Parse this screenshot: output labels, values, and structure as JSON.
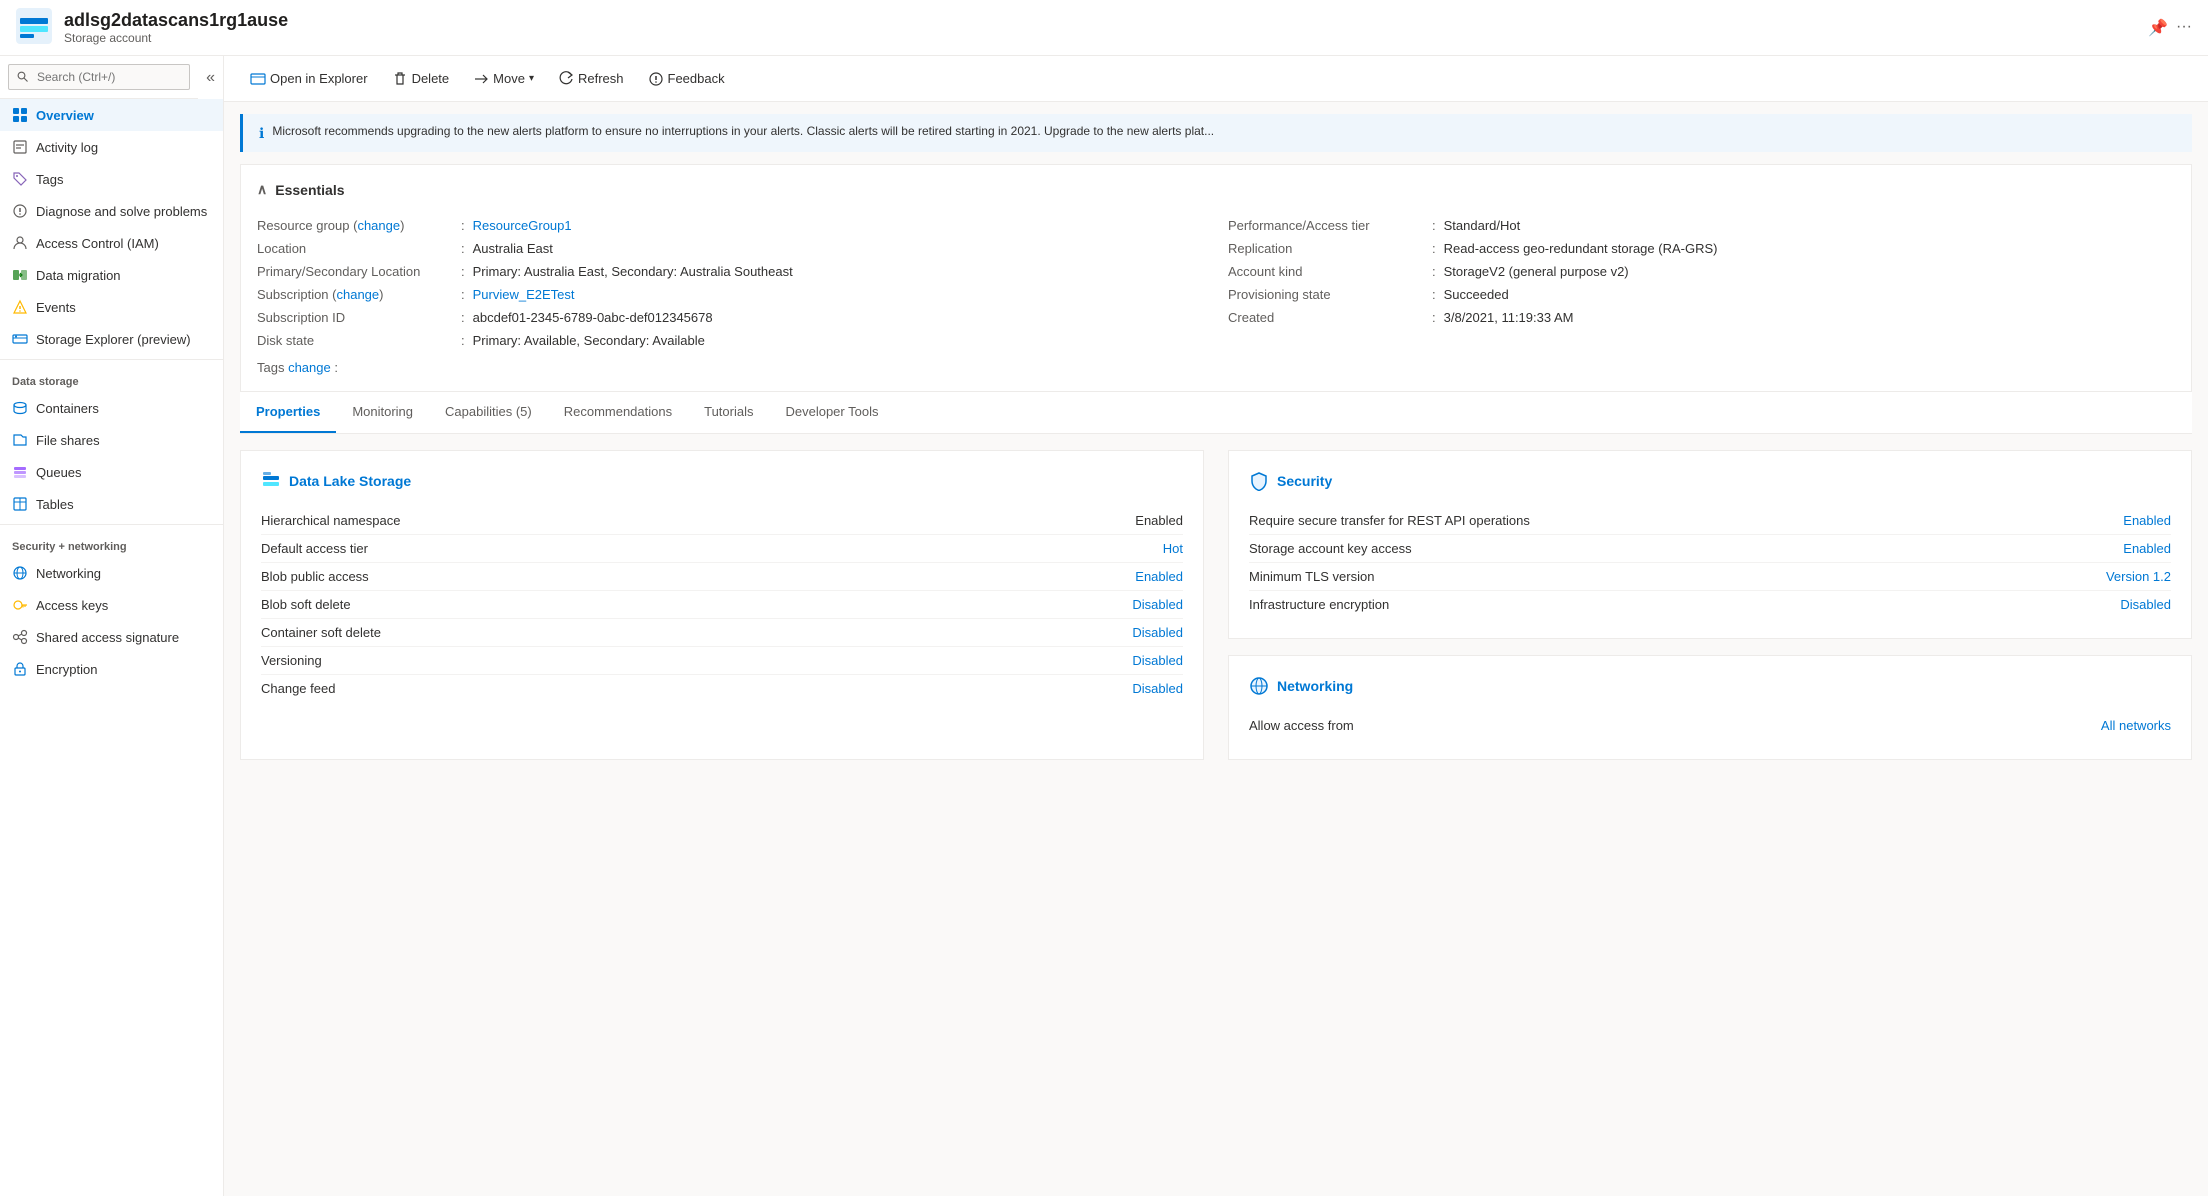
{
  "header": {
    "title": "adlsg2datascans1rg1ause",
    "subtitle": "Storage account",
    "pin_tooltip": "Pin",
    "more_tooltip": "More"
  },
  "toolbar": {
    "open_explorer": "Open in Explorer",
    "delete": "Delete",
    "move": "Move",
    "refresh": "Refresh",
    "feedback": "Feedback"
  },
  "alert": {
    "text": "Microsoft recommends upgrading to the new alerts platform to ensure no interruptions in your alerts. Classic alerts will be retired starting in 2021. Upgrade to the new alerts plat..."
  },
  "essentials": {
    "title": "Essentials",
    "fields_left": [
      {
        "label": "Resource group (change)",
        "value": "ResourceGroup1",
        "link": true
      },
      {
        "label": "Location",
        "value": "Australia East",
        "link": false
      },
      {
        "label": "Primary/Secondary Location",
        "value": "Primary: Australia East, Secondary: Australia Southeast",
        "link": false
      },
      {
        "label": "Subscription (change)",
        "value": "Purview_E2ETest",
        "link": true
      },
      {
        "label": "Subscription ID",
        "value": "abcdef01-2345-6789-0abc-def012345678",
        "link": false
      },
      {
        "label": "Disk state",
        "value": "Primary: Available, Secondary: Available",
        "link": false
      }
    ],
    "fields_right": [
      {
        "label": "Performance/Access tier",
        "value": "Standard/Hot",
        "link": false
      },
      {
        "label": "Replication",
        "value": "Read-access geo-redundant storage (RA-GRS)",
        "link": false
      },
      {
        "label": "Account kind",
        "value": "StorageV2 (general purpose v2)",
        "link": false
      },
      {
        "label": "Provisioning state",
        "value": "Succeeded",
        "link": false
      },
      {
        "label": "Created",
        "value": "3/8/2021, 11:19:33 AM",
        "link": false
      }
    ],
    "tags_label": "Tags",
    "tags_change": "change"
  },
  "tabs": [
    {
      "id": "properties",
      "label": "Properties",
      "active": true
    },
    {
      "id": "monitoring",
      "label": "Monitoring",
      "active": false
    },
    {
      "id": "capabilities",
      "label": "Capabilities (5)",
      "active": false
    },
    {
      "id": "recommendations",
      "label": "Recommendations",
      "active": false
    },
    {
      "id": "tutorials",
      "label": "Tutorials",
      "active": false
    },
    {
      "id": "developer_tools",
      "label": "Developer Tools",
      "active": false
    }
  ],
  "properties": {
    "data_lake": {
      "title": "Data Lake Storage",
      "rows": [
        {
          "label": "Hierarchical namespace",
          "value": "Enabled",
          "type": "plain"
        },
        {
          "label": "Default access tier",
          "value": "Hot",
          "type": "link"
        },
        {
          "label": "Blob public access",
          "value": "Enabled",
          "type": "link"
        },
        {
          "label": "Blob soft delete",
          "value": "Disabled",
          "type": "link"
        },
        {
          "label": "Container soft delete",
          "value": "Disabled",
          "type": "link"
        },
        {
          "label": "Versioning",
          "value": "Disabled",
          "type": "link"
        },
        {
          "label": "Change feed",
          "value": "Disabled",
          "type": "link"
        }
      ]
    },
    "security": {
      "title": "Security",
      "rows": [
        {
          "label": "Require secure transfer for REST API operations",
          "value": "Enabled",
          "type": "link"
        },
        {
          "label": "Storage account key access",
          "value": "Enabled",
          "type": "link"
        },
        {
          "label": "Minimum TLS version",
          "value": "Version 1.2",
          "type": "link"
        },
        {
          "label": "Infrastructure encryption",
          "value": "Disabled",
          "type": "link"
        }
      ]
    },
    "networking": {
      "title": "Networking",
      "rows": [
        {
          "label": "Allow access from",
          "value": "All networks",
          "type": "link"
        }
      ]
    }
  },
  "sidebar": {
    "search_placeholder": "Search (Ctrl+/)",
    "items_top": [
      {
        "id": "overview",
        "label": "Overview",
        "icon": "overview",
        "active": true
      },
      {
        "id": "activity_log",
        "label": "Activity log",
        "icon": "activity",
        "active": false
      },
      {
        "id": "tags",
        "label": "Tags",
        "icon": "tags",
        "active": false
      },
      {
        "id": "diagnose",
        "label": "Diagnose and solve problems",
        "icon": "diagnose",
        "active": false
      },
      {
        "id": "access_control",
        "label": "Access Control (IAM)",
        "icon": "iam",
        "active": false
      },
      {
        "id": "data_migration",
        "label": "Data migration",
        "icon": "migration",
        "active": false
      },
      {
        "id": "events",
        "label": "Events",
        "icon": "events",
        "active": false
      },
      {
        "id": "storage_explorer",
        "label": "Storage Explorer (preview)",
        "icon": "storage_explorer",
        "active": false
      }
    ],
    "section_data_storage": "Data storage",
    "items_data_storage": [
      {
        "id": "containers",
        "label": "Containers",
        "icon": "containers",
        "active": false
      },
      {
        "id": "file_shares",
        "label": "File shares",
        "icon": "file_shares",
        "active": false
      },
      {
        "id": "queues",
        "label": "Queues",
        "icon": "queues",
        "active": false
      },
      {
        "id": "tables",
        "label": "Tables",
        "icon": "tables",
        "active": false
      }
    ],
    "section_security": "Security + networking",
    "items_security": [
      {
        "id": "networking",
        "label": "Networking",
        "icon": "networking",
        "active": false
      },
      {
        "id": "access_keys",
        "label": "Access keys",
        "icon": "access_keys",
        "active": false
      },
      {
        "id": "shared_access",
        "label": "Shared access signature",
        "icon": "shared_access",
        "active": false
      },
      {
        "id": "encryption",
        "label": "Encryption",
        "icon": "encryption",
        "active": false
      }
    ]
  }
}
